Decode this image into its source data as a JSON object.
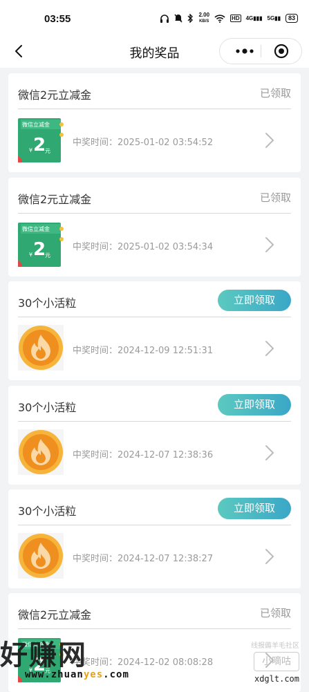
{
  "status_bar": {
    "time": "03:55",
    "net_speed_value": "2.00",
    "net_speed_unit": "KB/S",
    "hd": "HD",
    "signal1": "4G",
    "signal2": "5G",
    "battery": "83"
  },
  "nav": {
    "title": "我的奖品",
    "back_icon": "back-arrow-icon",
    "more_icon": "more-dots-icon",
    "close_icon": "target-close-icon"
  },
  "card_labels": {
    "win_time_prefix": "中奖时间："
  },
  "prizes": [
    {
      "title": "微信2元立减金",
      "status": "已领取",
      "type": "voucher",
      "time": "2025-01-02 03:54:52",
      "img_top": "微信立减金",
      "img_amount": "2",
      "img_unit": "元",
      "img_currency": "¥"
    },
    {
      "title": "微信2元立减金",
      "status": "已领取",
      "type": "voucher",
      "time": "2025-01-02 03:54:34",
      "img_top": "微信立减金",
      "img_amount": "2",
      "img_unit": "元",
      "img_currency": "¥"
    },
    {
      "title": "30个小活粒",
      "action": "立即领取",
      "type": "coin",
      "time": "2024-12-09 12:51:31"
    },
    {
      "title": "30个小活粒",
      "action": "立即领取",
      "type": "coin",
      "time": "2024-12-07 12:38:36"
    },
    {
      "title": "30个小活粒",
      "action": "立即领取",
      "type": "coin",
      "time": "2024-12-07 12:38:27"
    },
    {
      "title": "微信2元立减金",
      "status": "已领取",
      "type": "voucher",
      "time": "2024-12-02 08:08:28",
      "img_top": "微信立减金",
      "img_amount": "2",
      "img_unit": "元",
      "img_currency": "¥"
    }
  ],
  "watermark": {
    "brand": "好赚网",
    "url_a": "www.zhuan",
    "url_b": "yes",
    "url_c": ".com",
    "right_top": "线报薅羊毛社区",
    "right_box": "小嘀咕",
    "right_url": "xdglt.com"
  },
  "colors": {
    "claim_btn_start": "#5cc9c0",
    "claim_btn_end": "#3aa7c7",
    "voucher_green": "#2fa872",
    "coin_orange": "#f39c2a"
  }
}
